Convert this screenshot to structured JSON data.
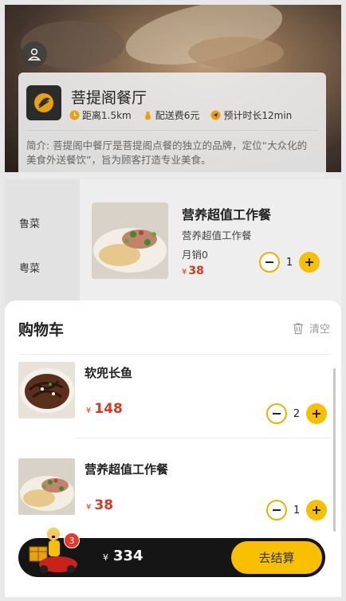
{
  "shop": {
    "name": "菩提阁餐厅",
    "distance": "距离1.5km",
    "delivery_fee": "配送费6元",
    "eta": "预计时长12min",
    "intro": "简介: 菩提阁中餐厅是菩提阁点餐的独立的品牌，定位“大众化的美食外送餐饮”，旨为顾客打造专业美食。"
  },
  "categories": [
    "鲁菜",
    "粤菜"
  ],
  "menu_dish": {
    "title": "营养超值工作餐",
    "subtitle": "营养超值工作餐",
    "sales": "月销0",
    "currency": "¥",
    "price": "38",
    "qty": "1"
  },
  "cart": {
    "title": "购物车",
    "clear_label": "清空",
    "items": [
      {
        "name": "软兜长鱼",
        "currency": "¥",
        "price": "148",
        "qty": "2"
      },
      {
        "name": "营养超值工作餐",
        "currency": "¥",
        "price": "38",
        "qty": "1"
      }
    ]
  },
  "bottom_bar": {
    "badge_count": "3",
    "currency": "¥",
    "total": "334",
    "checkout_label": "去结算"
  },
  "colors": {
    "accent": "#f6c000",
    "price": "#d9381e",
    "bar": "#151515"
  },
  "icons": [
    "user-icon",
    "shop-logo-icon",
    "clock-icon",
    "money-bag-icon",
    "navigation-icon",
    "trash-icon",
    "minus-icon",
    "plus-icon",
    "delivery-mascot-icon"
  ]
}
